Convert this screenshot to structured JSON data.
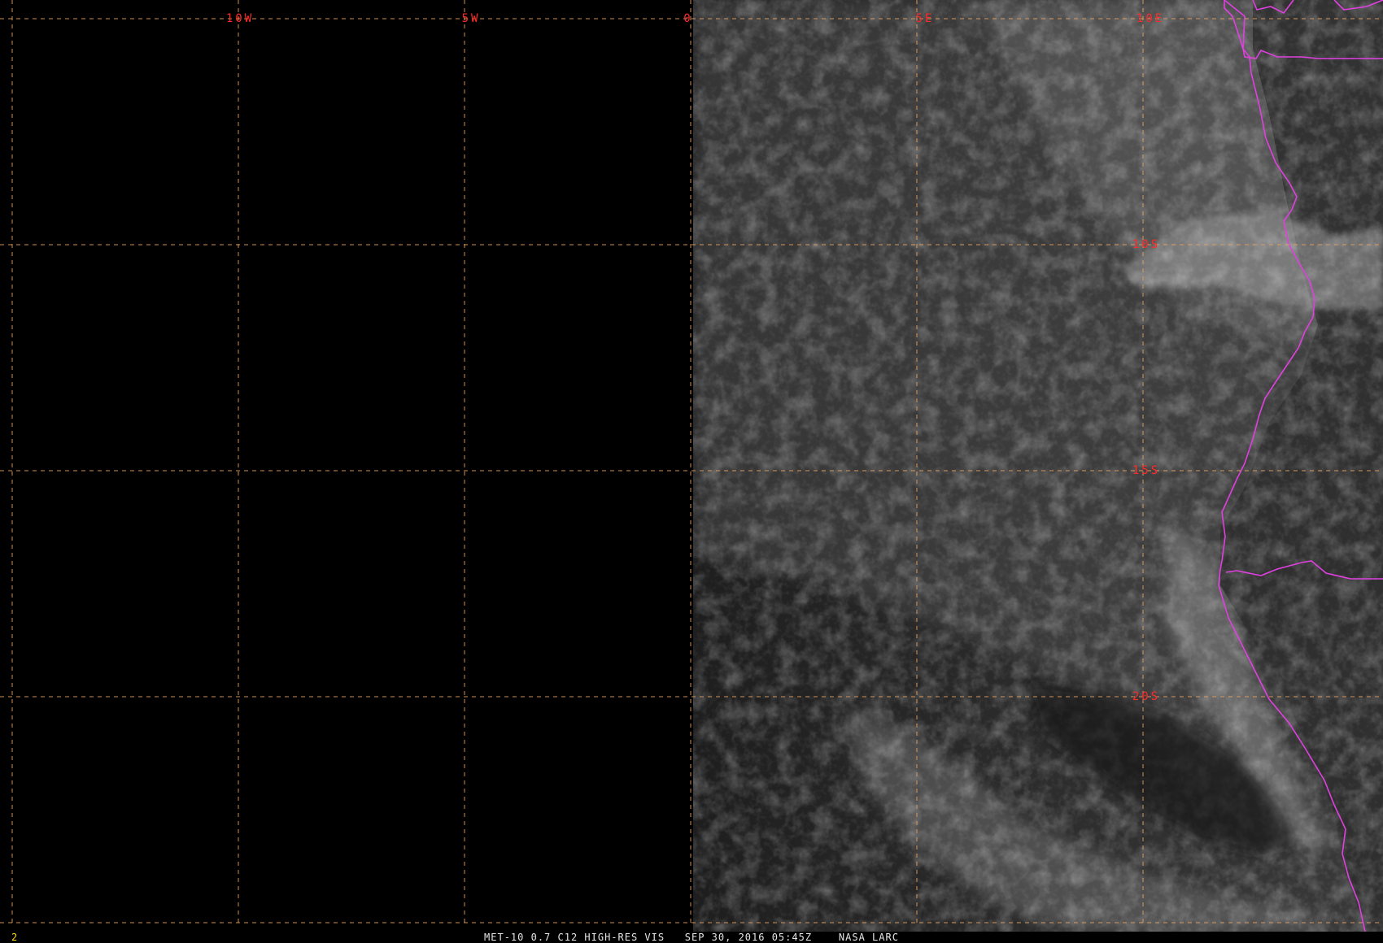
{
  "product": {
    "caption": "MET-10 0.7 C12 HIGH-RES VIS   SEP 30, 2016 05:45Z    NASA LARC",
    "frame_number": "2"
  },
  "graticule": {
    "longitude_labels": [
      "10W",
      "5W",
      "0",
      "5E",
      "10E"
    ],
    "latitude_labels": [
      "10S",
      "15S",
      "20S"
    ],
    "line_color": "#e8a060",
    "label_color": "#ff2a2a"
  },
  "overlays": {
    "coastline_color": "#e040e0"
  },
  "imagery": {
    "type": "visible satellite imagery",
    "no_data_color": "#000000"
  }
}
